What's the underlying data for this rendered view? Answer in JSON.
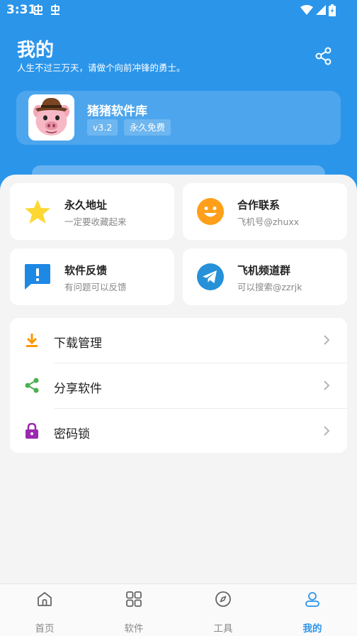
{
  "status_bar": {
    "time": "3:31"
  },
  "header": {
    "title": "我的",
    "subtitle": "人生不过三万天，请做个向前冲锋的勇士。"
  },
  "profile": {
    "app_name": "猪猪软件库",
    "version": "v3.2",
    "license": "永久免费"
  },
  "grid": [
    {
      "title": "永久地址",
      "subtitle": "一定要收藏起来",
      "icon": "star-icon"
    },
    {
      "title": "合作联系",
      "subtitle": "飞机号@zhuxx",
      "icon": "smile-icon"
    },
    {
      "title": "软件反馈",
      "subtitle": "有问题可以反馈",
      "icon": "feedback-icon"
    },
    {
      "title": "飞机频道群",
      "subtitle": "可以搜索@zzrjk",
      "icon": "telegram-icon"
    }
  ],
  "menu": [
    {
      "label": "下载管理",
      "icon": "download-icon"
    },
    {
      "label": "分享软件",
      "icon": "share-icon"
    },
    {
      "label": "密码锁",
      "icon": "lock-icon"
    }
  ],
  "nav": [
    {
      "label": "首页",
      "icon": "home-icon"
    },
    {
      "label": "软件",
      "icon": "grid-icon"
    },
    {
      "label": "工具",
      "icon": "compass-icon"
    },
    {
      "label": "我的",
      "icon": "user-icon",
      "active": true
    }
  ],
  "colors": {
    "primary": "#2b95ea",
    "star": "#fdd835",
    "smile": "#ff9f1a",
    "feedback": "#1e88e5",
    "telegram": "#2690d8",
    "download": "#ff9800",
    "share": "#4caf50",
    "lock": "#9c27b0"
  }
}
